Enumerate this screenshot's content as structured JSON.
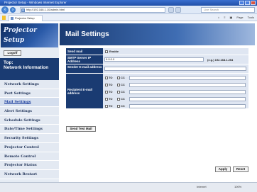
{
  "browser": {
    "window_title": "Projector Setup - Windows Internet Explorer",
    "url": "http://192.168.1.10/admin.html",
    "search_placeholder": "Live Search",
    "tab_label": "Projector Setup",
    "tools": [
      "Page",
      "Tools"
    ]
  },
  "sidebar": {
    "logo": "Projector Setup",
    "logoff_label": "Logoff",
    "top_label": "Top:",
    "top_sub": "Network Information",
    "items": [
      "Network Settings",
      "Port Settings",
      "Mail Settings",
      "Alert Settings",
      "Schedule Settings",
      "Date/Time Settings",
      "Security Settings",
      "Projector Control",
      "Remote Control",
      "Projector Status",
      "Network Restart"
    ],
    "active_index": 2
  },
  "main": {
    "title": "Mail Settings",
    "send_mail_label": "Send mail",
    "enable_label": "Enable",
    "smtp_label": "SMTP Server IP Address",
    "smtp_value": "0.0.0.0",
    "smtp_hint": "(e.g.) 192.168.1.254",
    "sender_label": "Sender E-mail address",
    "sender_value": "",
    "recipient_label": "Recipient E-mail address",
    "to_label": "TO",
    "cc_label": "CC",
    "recipient_rows": 5,
    "send_test_label": "Send Test Mail",
    "apply_label": "Apply",
    "reset_label": "Reset"
  },
  "status": {
    "zone": "Internet",
    "zoom": "100%"
  }
}
